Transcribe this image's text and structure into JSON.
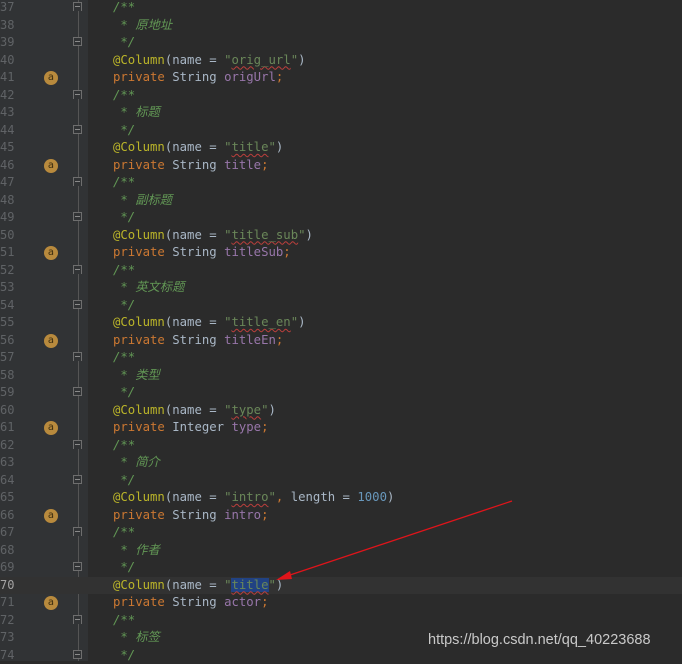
{
  "editor": {
    "lines": [
      {
        "n": "37",
        "kind": "doc-open"
      },
      {
        "n": "38",
        "kind": "doc-text",
        "text": "原地址"
      },
      {
        "n": "39",
        "kind": "doc-close"
      },
      {
        "n": "40",
        "kind": "column",
        "name": "orig_url"
      },
      {
        "n": "41",
        "kind": "field",
        "type": "String",
        "field": "origUrl"
      },
      {
        "n": "42",
        "kind": "doc-open"
      },
      {
        "n": "43",
        "kind": "doc-text",
        "text": "标题"
      },
      {
        "n": "44",
        "kind": "doc-close"
      },
      {
        "n": "45",
        "kind": "column",
        "name": "title"
      },
      {
        "n": "46",
        "kind": "field",
        "type": "String",
        "field": "title"
      },
      {
        "n": "47",
        "kind": "doc-open"
      },
      {
        "n": "48",
        "kind": "doc-text",
        "text": "副标题"
      },
      {
        "n": "49",
        "kind": "doc-close"
      },
      {
        "n": "50",
        "kind": "column",
        "name": "title_sub"
      },
      {
        "n": "51",
        "kind": "field",
        "type": "String",
        "field": "titleSub"
      },
      {
        "n": "52",
        "kind": "doc-open"
      },
      {
        "n": "53",
        "kind": "doc-text",
        "text": "英文标题"
      },
      {
        "n": "54",
        "kind": "doc-close"
      },
      {
        "n": "55",
        "kind": "column",
        "name": "title_en"
      },
      {
        "n": "56",
        "kind": "field",
        "type": "String",
        "field": "titleEn"
      },
      {
        "n": "57",
        "kind": "doc-open"
      },
      {
        "n": "58",
        "kind": "doc-text",
        "text": "类型"
      },
      {
        "n": "59",
        "kind": "doc-close"
      },
      {
        "n": "60",
        "kind": "column",
        "name": "type"
      },
      {
        "n": "61",
        "kind": "field",
        "type": "Integer",
        "field": "type"
      },
      {
        "n": "62",
        "kind": "doc-open"
      },
      {
        "n": "63",
        "kind": "doc-text",
        "text": "简介"
      },
      {
        "n": "64",
        "kind": "doc-close"
      },
      {
        "n": "65",
        "kind": "column",
        "name": "intro",
        "length": "1000"
      },
      {
        "n": "66",
        "kind": "field",
        "type": "String",
        "field": "intro"
      },
      {
        "n": "67",
        "kind": "doc-open"
      },
      {
        "n": "68",
        "kind": "doc-text",
        "text": "作者"
      },
      {
        "n": "69",
        "kind": "doc-close"
      },
      {
        "n": "70",
        "kind": "column",
        "name": "title",
        "current": true,
        "selected": true
      },
      {
        "n": "71",
        "kind": "field",
        "type": "String",
        "field": "actor"
      },
      {
        "n": "72",
        "kind": "doc-open"
      },
      {
        "n": "73",
        "kind": "doc-text",
        "text": "标签"
      },
      {
        "n": "74",
        "kind": "doc-close"
      }
    ],
    "tokens": {
      "annotation": "@Column",
      "name_kw": "name",
      "length_kw": "length",
      "modifier": "private",
      "doc_open": "/**",
      "doc_star": " * ",
      "doc_close": " */",
      "gutter_icon_letter": "a"
    }
  },
  "annotation_overlay": {
    "arrow_color": "#e0141a",
    "points_to_line": "70"
  },
  "watermark": "https://blog.csdn.net/qq_40223688",
  "colors": {
    "background": "#2b2b2b",
    "gutter": "#313335",
    "keyword": "#cc7832",
    "annotation": "#bbb529",
    "comment": "#629755",
    "string": "#6a8759",
    "field": "#9876aa",
    "number": "#6897bb",
    "text": "#a9b7c6",
    "selection": "#214283"
  }
}
